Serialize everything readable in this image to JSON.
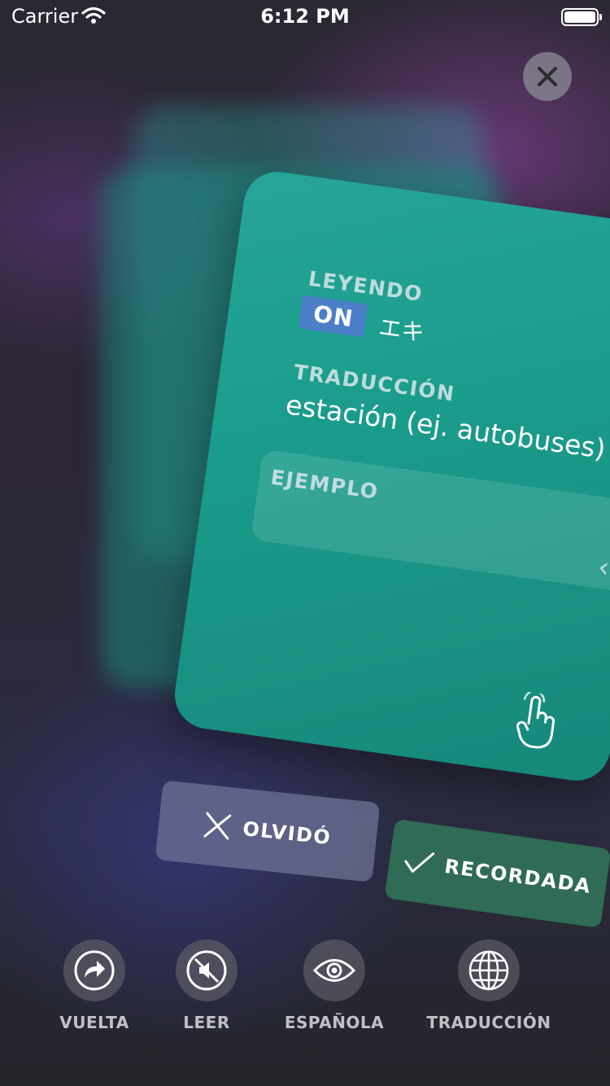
{
  "status_bar": {
    "carrier": "Carrier",
    "time": "6:12 PM"
  },
  "card": {
    "reading_label": "LEYENDO",
    "reading_toggle": "ON",
    "reading_value": "エキ",
    "translation_label": "TRADUCCIÓN",
    "translation_value": "estación (ej. autobuses)",
    "example_label": "EJEMPLO"
  },
  "actions": {
    "forgot": "OLVIDÓ",
    "remembered": "RECORDADA"
  },
  "toolbar": [
    {
      "label": "VUELTA",
      "icon": "flip-arrow-icon"
    },
    {
      "label": "LEER",
      "icon": "speaker-muted-icon"
    },
    {
      "label": "ESPAÑOLA",
      "icon": "eye-icon"
    },
    {
      "label": "TRADUCCIÓN",
      "icon": "globe-icon"
    }
  ],
  "colors": {
    "card": "#1a9c8c",
    "remembered": "#2f6b55",
    "on_badge": "#4b7fc8"
  }
}
